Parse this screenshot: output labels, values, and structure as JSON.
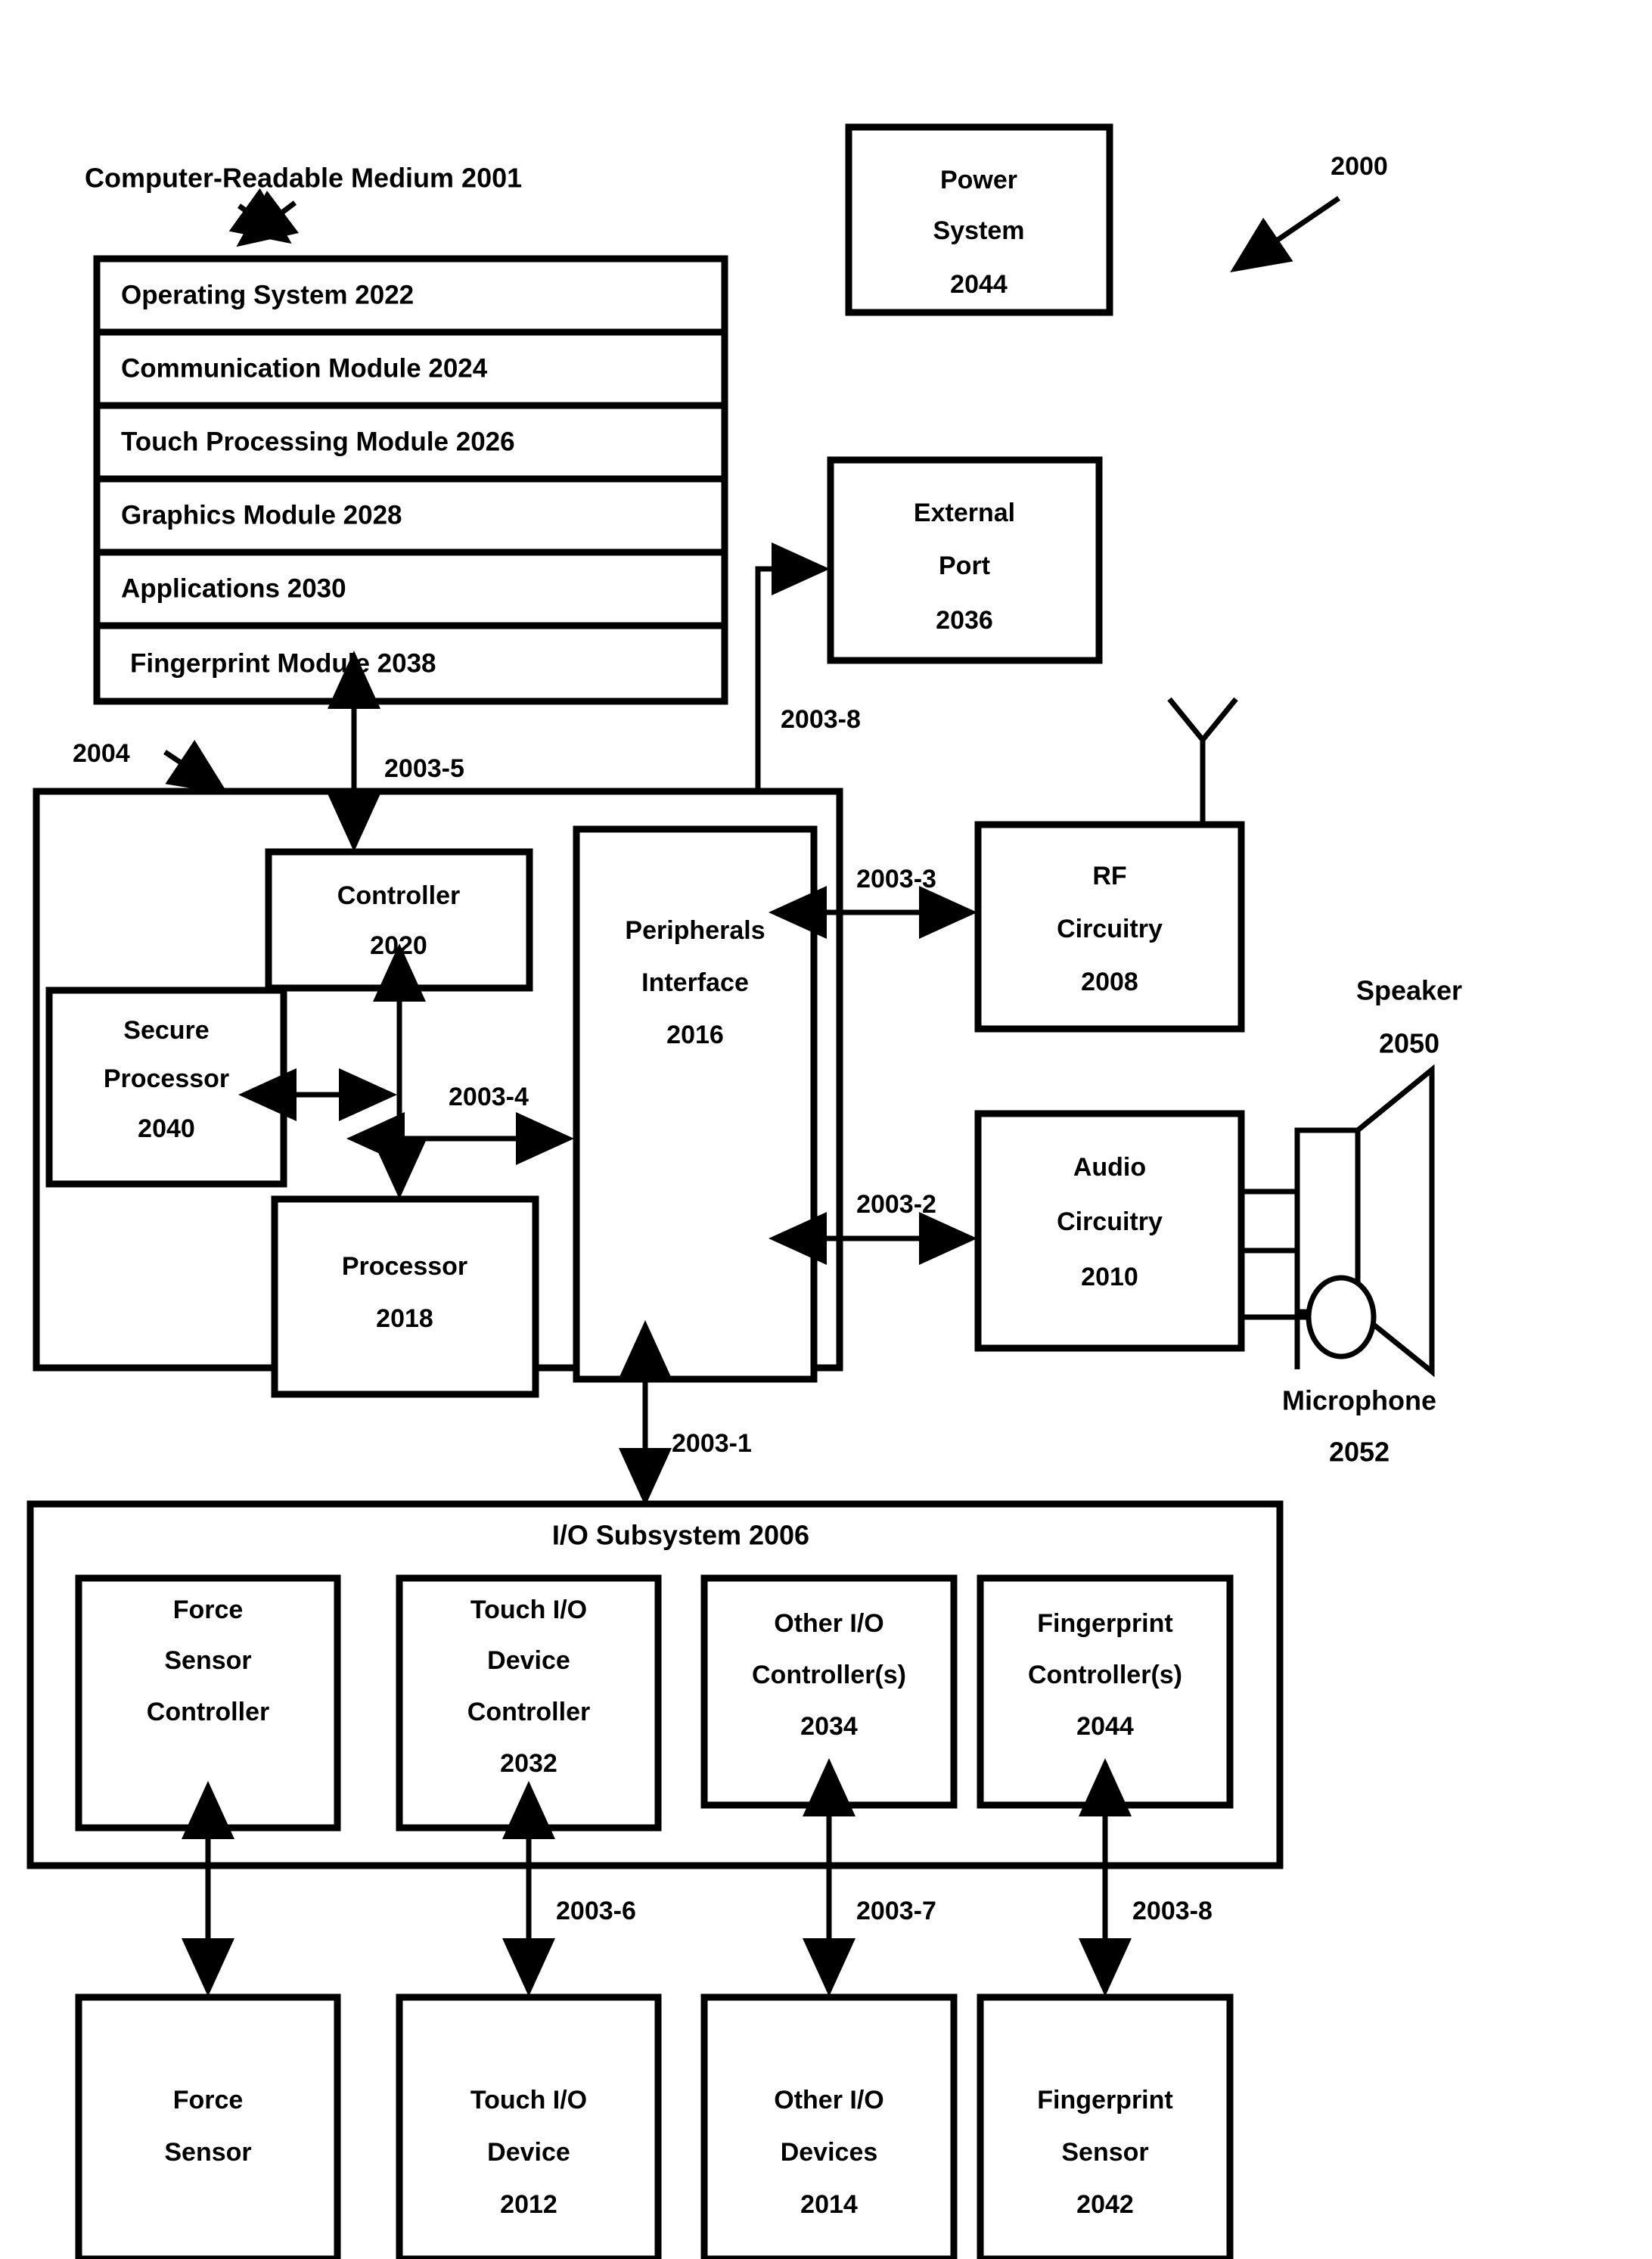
{
  "figure": {
    "id_label": "2000",
    "crm_label": "Computer-Readable Medium 2001",
    "device_label": "2004",
    "io_subsystem_title": "I/O Subsystem 2006"
  },
  "crm_modules": [
    {
      "label": "Operating System 2022"
    },
    {
      "label": "Communication Module 2024"
    },
    {
      "label": "Touch Processing Module 2026"
    },
    {
      "label": "Graphics Module 2028"
    },
    {
      "label": "Applications 2030"
    },
    {
      "label": "Fingerprint Module 2038"
    }
  ],
  "power_system": {
    "lines": [
      "Power",
      "System",
      "2044"
    ]
  },
  "external_port": {
    "lines": [
      "External",
      "Port",
      "2036"
    ]
  },
  "controller": {
    "lines": [
      "Controller",
      "2020"
    ]
  },
  "secure_processor": {
    "lines": [
      "Secure",
      "Processor",
      "2040"
    ]
  },
  "processor": {
    "lines": [
      "Processor",
      "2018"
    ]
  },
  "peripherals_interface": {
    "lines": [
      "Peripherals",
      "Interface",
      "2016"
    ]
  },
  "rf_circuitry": {
    "lines": [
      "RF",
      "Circuitry",
      "2008"
    ]
  },
  "audio_circuitry": {
    "lines": [
      "Audio",
      "Circuitry",
      "2010"
    ]
  },
  "speaker": {
    "lines": [
      "Speaker",
      "2050"
    ]
  },
  "microphone": {
    "lines": [
      "Microphone",
      "2052"
    ]
  },
  "io_controllers": [
    {
      "lines": [
        "Force",
        "Sensor",
        "Controller"
      ]
    },
    {
      "lines": [
        "Touch I/O",
        "Device",
        "Controller",
        "2032"
      ]
    },
    {
      "lines": [
        "Other I/O",
        "Controller(s)",
        "2034"
      ]
    },
    {
      "lines": [
        "Fingerprint",
        "Controller(s)",
        "2044"
      ]
    }
  ],
  "io_devices": [
    {
      "lines": [
        "Force",
        "Sensor"
      ]
    },
    {
      "lines": [
        "Touch I/O",
        "Device",
        "2012"
      ]
    },
    {
      "lines": [
        "Other I/O",
        "Devices",
        "2014"
      ]
    },
    {
      "lines": [
        "Fingerprint",
        "Sensor",
        "2042"
      ]
    }
  ],
  "bus_labels": {
    "bus_1": "2003-1",
    "bus_2": "2003-2",
    "bus_3": "2003-3",
    "bus_4": "2003-4",
    "bus_5": "2003-5",
    "bus_6": "2003-6",
    "bus_7": "2003-7",
    "bus_8_port": "2003-8",
    "bus_8_fp": "2003-8"
  },
  "colors": {
    "ink": "#000000",
    "paper": "#ffffff"
  }
}
